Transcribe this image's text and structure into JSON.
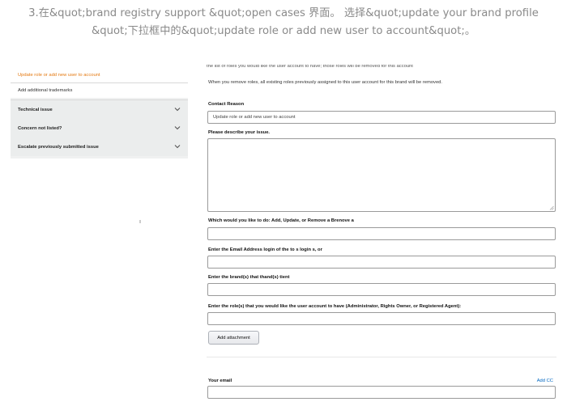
{
  "caption": {
    "line1": "3.在&quot;brand registry support &quot;open cases 界面。 选择&quot;update your brand profile",
    "line2": "&quot;下拉框中的&quot;update role or add new user to account&quot;。"
  },
  "sidebar": {
    "selected_label": "Update role or add new user to account",
    "sub_label": "Add additional trademarks",
    "items": [
      {
        "label": "Technical issue",
        "icon": "chevron-down-icon"
      },
      {
        "label": "Concern not listed?",
        "icon": "chevron-down-icon"
      },
      {
        "label": "Escalate previously submitted issue",
        "icon": "chevron-down-icon"
      }
    ]
  },
  "form": {
    "top_text": "the list of roles you would like the user account to have; those roles will be removed for this account",
    "remove_note": "When you remove roles, all existing roles previously assigned to this user account for this brand will be removed.",
    "contact_reason_label": "Contact Reason",
    "contact_reason_value": "Update role or add new user to account",
    "describe_label": "Please describe your issue.",
    "q1_label": "Which would you like to do: Add, Update, or Remove a Brenove a",
    "q2_label": "Enter the Email Address login of the to s login s, or",
    "q3_label": "Enter the brand(s) that thand(s) tient",
    "q4_label": "Enter the role(s) that you would like the user account to have (Administrator, Rights Owner, or Registered Agent):",
    "attach_label": "Add attachment",
    "email_label": "Your email",
    "add_cc": "Add CC"
  },
  "colors": {
    "selected_text": "#e47911",
    "link": "#0066c0",
    "sidebar_bg": "#f0f1f1",
    "caption_text": "#8a8a8a"
  }
}
